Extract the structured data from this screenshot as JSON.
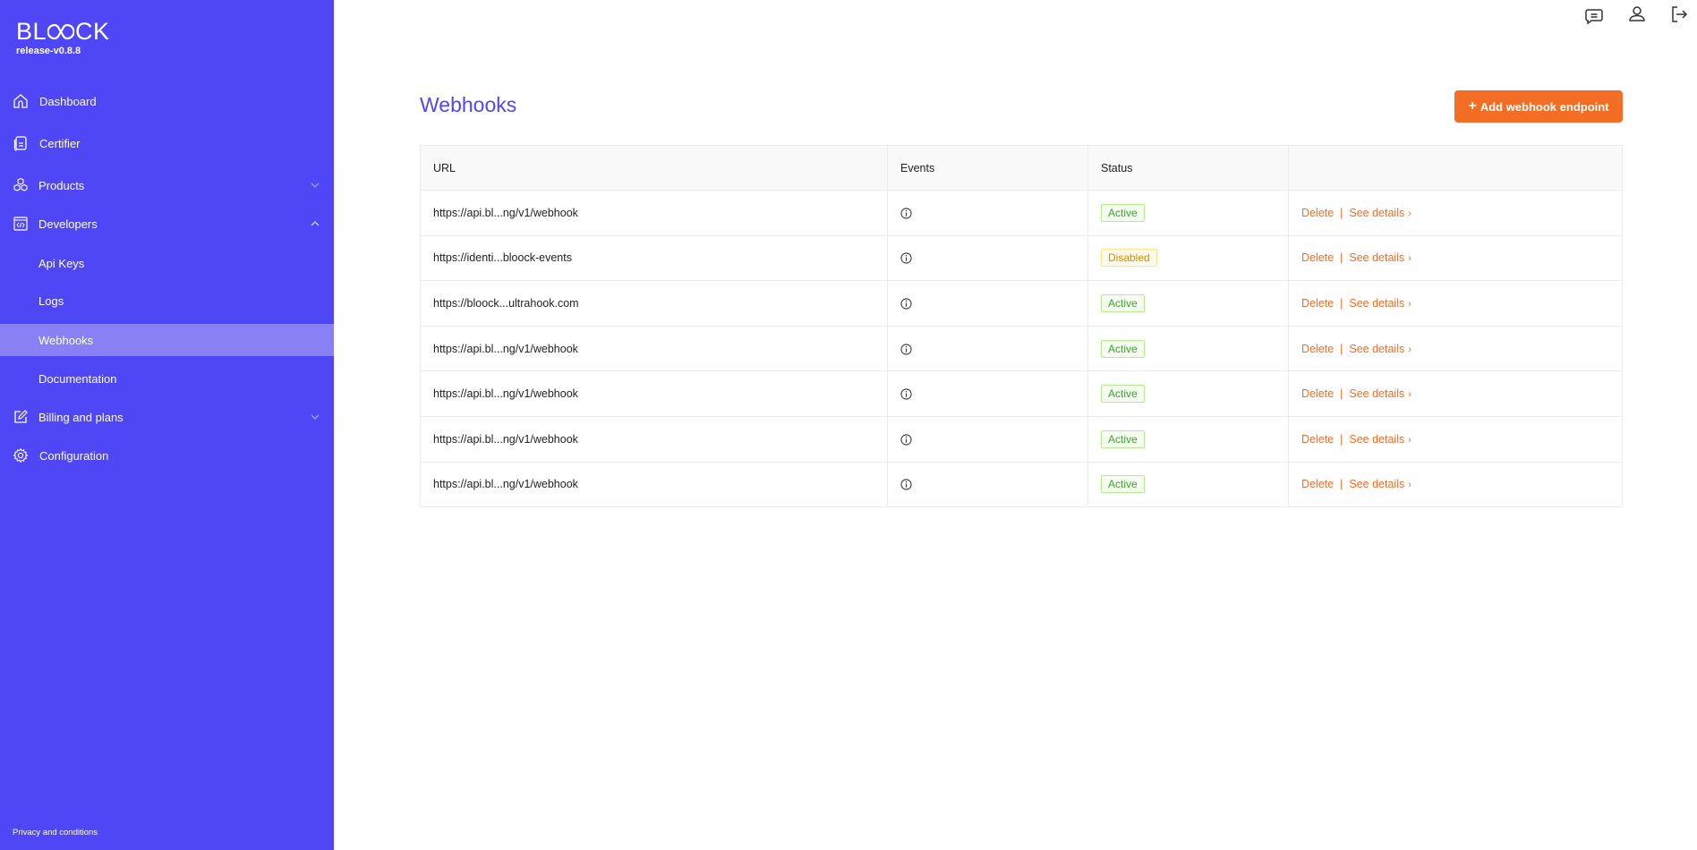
{
  "brand": {
    "logo": "BLOOCK",
    "version": "release-v0.8.8"
  },
  "sidebar": {
    "items": [
      {
        "label": "Dashboard",
        "icon": "home-icon"
      },
      {
        "label": "Certifier",
        "icon": "document-icon"
      },
      {
        "label": "Products",
        "icon": "boxes-icon",
        "expandable": true,
        "expanded": false
      },
      {
        "label": "Developers",
        "icon": "code-window-icon",
        "expandable": true,
        "expanded": true
      },
      {
        "label": "Api Keys",
        "sub": true
      },
      {
        "label": "Logs",
        "sub": true
      },
      {
        "label": "Webhooks",
        "sub": true,
        "active": true
      },
      {
        "label": "Documentation",
        "sub": true
      },
      {
        "label": "Billing and plans",
        "icon": "edit-icon",
        "expandable": true,
        "expanded": false
      },
      {
        "label": "Configuration",
        "icon": "gear-icon"
      }
    ],
    "footer_link": "Privacy and conditions"
  },
  "header": {
    "icons": [
      "chat-icon",
      "user-icon",
      "logout-icon"
    ]
  },
  "main": {
    "title": "Webhooks",
    "add_button": "Add webhook endpoint",
    "table": {
      "columns": [
        "URL",
        "Events",
        "Status",
        ""
      ],
      "rows": [
        {
          "url": "https://api.bl...ng/v1/webhook",
          "status": "Active"
        },
        {
          "url": "https://identi...bloock-events",
          "status": "Disabled"
        },
        {
          "url": "https://bloock...ultrahook.com",
          "status": "Active"
        },
        {
          "url": "https://api.bl...ng/v1/webhook",
          "status": "Active"
        },
        {
          "url": "https://api.bl...ng/v1/webhook",
          "status": "Active"
        },
        {
          "url": "https://api.bl...ng/v1/webhook",
          "status": "Active"
        },
        {
          "url": "https://api.bl...ng/v1/webhook",
          "status": "Active"
        }
      ],
      "actions": {
        "delete": "Delete",
        "separator": "|",
        "details": "See details",
        "details_chevron": "›"
      }
    }
  },
  "colors": {
    "sidebar": "#4f46f5",
    "sidebar_active": "#8781f5",
    "accent": "#f36d24",
    "title": "#4f46f5",
    "active_badge": "#3aa52b",
    "disabled_badge": "#d4880c"
  }
}
